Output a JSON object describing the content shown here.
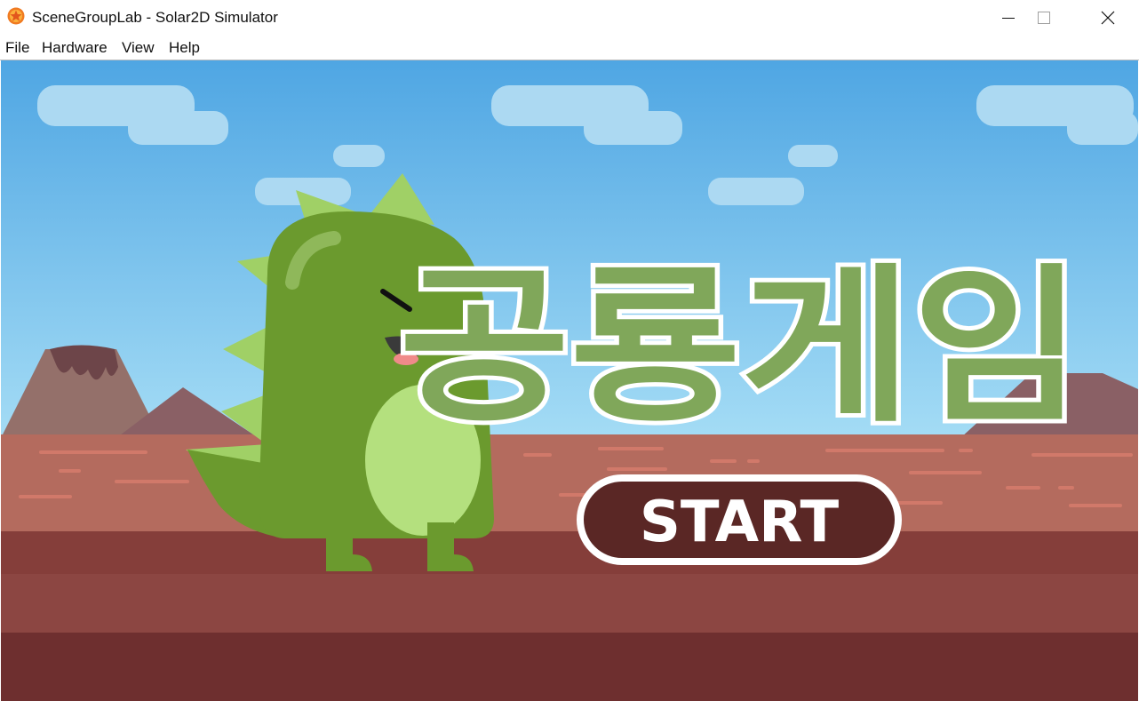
{
  "window": {
    "title": "SceneGroupLab - Solar2D Simulator",
    "app_icon": "solar2d-logo-icon",
    "controls": [
      "minimize-icon",
      "maximize-icon",
      "close-icon"
    ]
  },
  "menu": {
    "items": [
      {
        "label": "File"
      },
      {
        "label": "Hardware"
      },
      {
        "label": "View"
      },
      {
        "label": "Help"
      }
    ]
  },
  "game": {
    "title_logo": "공룡게임",
    "start_label": "START",
    "colors": {
      "sky_top": "#4fa6e3",
      "sky_bottom": "#9ad6f3",
      "ground": "#b46b5e",
      "ground_dark": "#853e3a",
      "dino_green": "#6b9a2e",
      "dino_light": "#b4e07e",
      "title_green": "#80a75a",
      "start_bg": "#5a2725"
    }
  }
}
